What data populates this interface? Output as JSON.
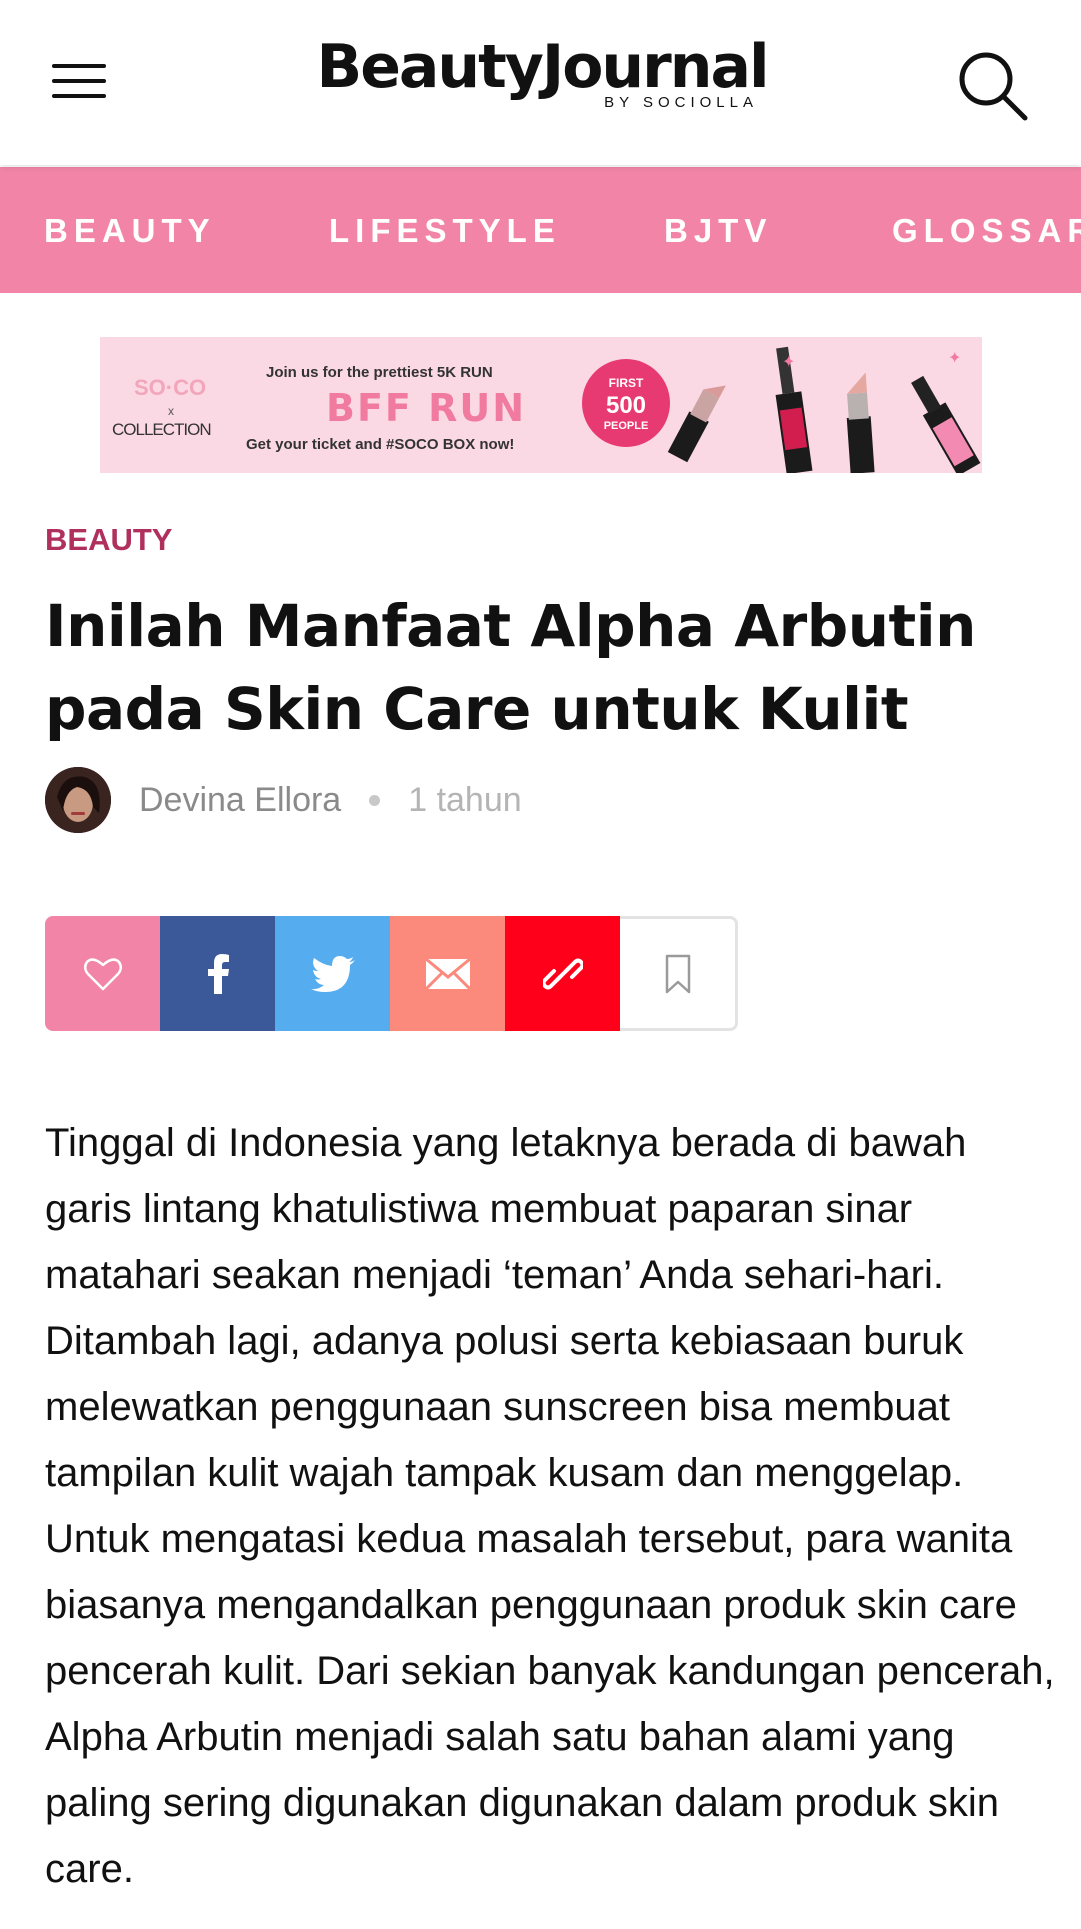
{
  "header": {
    "logo_main": "BeautyJournal",
    "logo_sub": "BY SOCIOLLA"
  },
  "nav": {
    "items": [
      "BEAUTY",
      "LIFESTYLE",
      "BJTV",
      "GLOSSARY"
    ]
  },
  "ad": {
    "brand_top": "SO·CO",
    "brand_x": "x",
    "brand_bottom": "COLLECTION",
    "headline_small": "Join us for the prettiest 5K RUN",
    "headline_big": "BFF RUN",
    "cta": "Get your ticket and #SOCO BOX now!",
    "badge_top": "FIRST",
    "badge_mid": "500",
    "badge_bottom": "PEOPLE"
  },
  "article": {
    "category": "BEAUTY",
    "title": "Inilah Manfaat Alpha Arbutin pada Skin Care untuk Kulit",
    "author": "Devina Ellora",
    "time": "1 tahun",
    "body": "Tinggal di Indonesia yang letaknya berada di bawah garis lintang khatulistiwa membuat paparan sinar matahari seakan menjadi ‘teman’ Anda sehari-hari. Ditambah lagi, adanya polusi serta kebiasaan buruk melewatkan penggunaan sunscreen bisa membuat tampilan kulit wajah tampak kusam dan menggelap. Untuk mengatasi kedua masalah tersebut, para wanita biasanya mengandalkan penggunaan produk skin care pencerah kulit. Dari sekian banyak kandungan pencerah, Alpha Arbutin menjadi salah satu bahan alami yang paling sering digunakan digunakan dalam produk skin care."
  },
  "share": {
    "buttons": [
      "heart-icon",
      "facebook-icon",
      "twitter-icon",
      "mail-icon",
      "link-icon",
      "bookmark-icon"
    ]
  },
  "colors": {
    "nav_pink": "#f285a7",
    "category": "#b0305d",
    "facebook": "#3b5998",
    "twitter": "#55acee",
    "mail": "#fb8a7c",
    "link": "#fe0019"
  }
}
